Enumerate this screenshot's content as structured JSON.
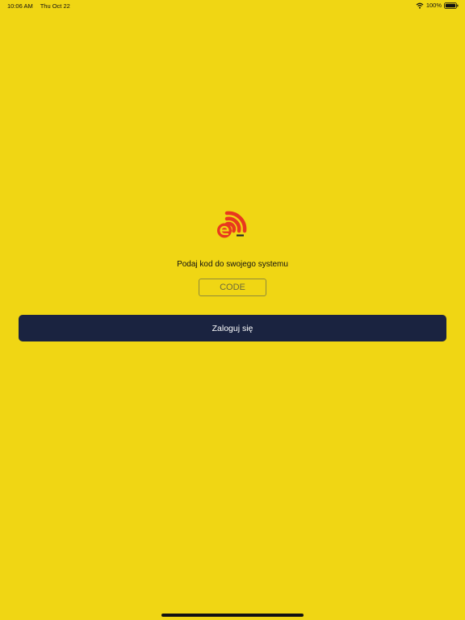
{
  "status_bar": {
    "time": "10:06 AM",
    "date": "Thu Oct 22",
    "battery": "100%",
    "wifi_icon": "wifi-icon",
    "battery_icon": "battery-icon"
  },
  "logo": {
    "icon": "signal-e-logo-icon",
    "colors": {
      "primary": "#e8391e"
    }
  },
  "login": {
    "prompt": "Podaj kod do swojego systemu",
    "code_placeholder": "CODE",
    "code_value": "",
    "button_label": "Zaloguj się"
  },
  "colors": {
    "background": "#f0d614",
    "button": "#1a2340",
    "button_text": "#ffffff"
  }
}
